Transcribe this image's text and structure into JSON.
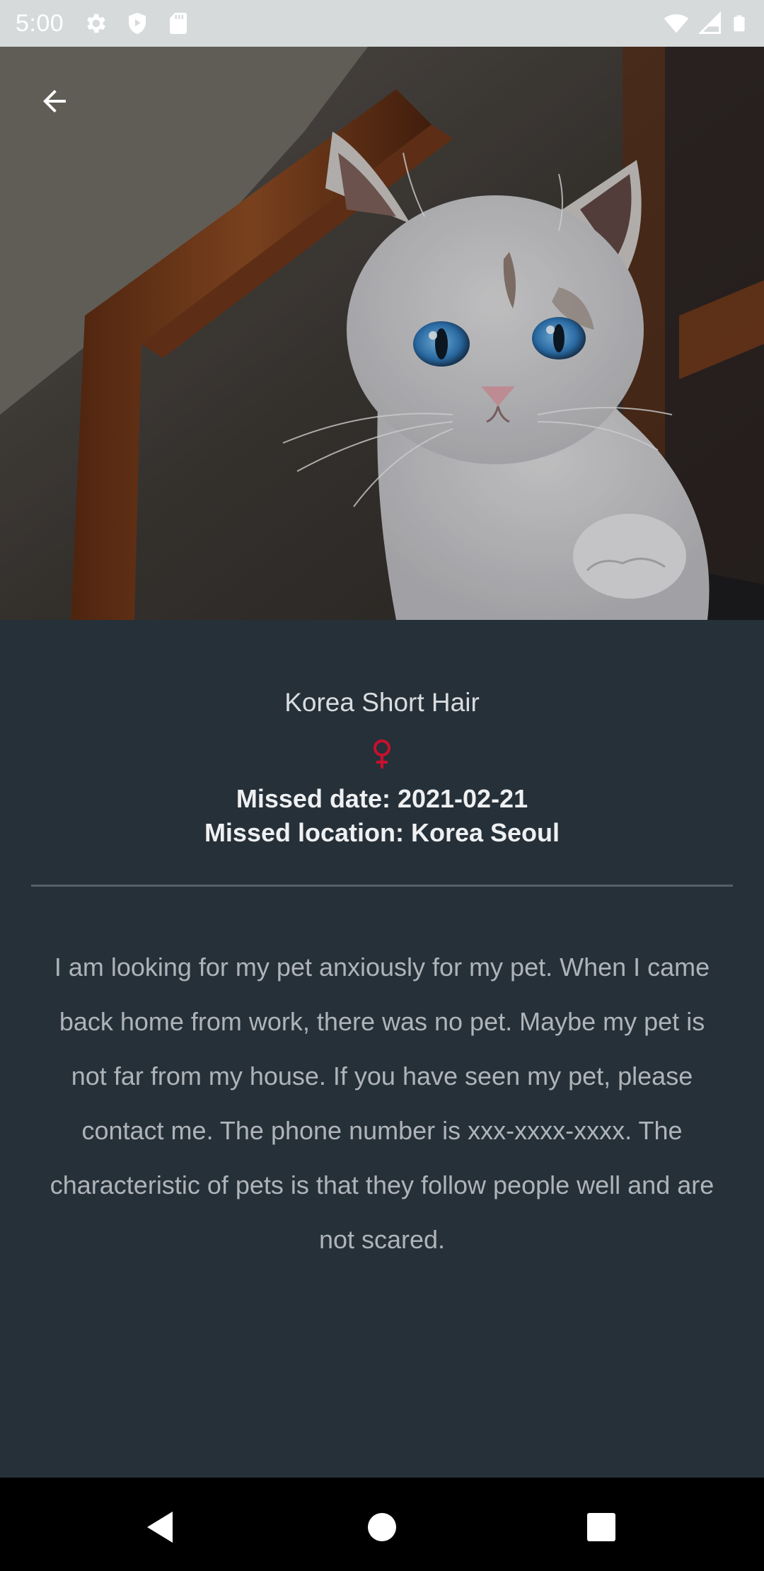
{
  "status_bar": {
    "time": "5:00",
    "left_icons": [
      "settings-icon",
      "shield-icon",
      "sd-card-icon"
    ],
    "right_icons": [
      "wifi-icon",
      "signal-icon",
      "battery-icon"
    ]
  },
  "hero": {
    "back_icon": "arrow-left-icon"
  },
  "pet": {
    "breed": "Korea Short Hair",
    "gender_icon": "female-icon",
    "gender_color": "#c8102e",
    "missed_date": "Missed date: 2021-02-21",
    "missed_location": "Missed location: Korea Seoul",
    "description": "I am looking for my pet anxiously for my pet. When I came back home from work, there was no pet. Maybe my pet is not far from my house. If you have seen my pet, please contact me. The phone number is xxx-xxxx-xxxx. The characteristic of pets is that they follow people well and are not scared."
  },
  "colors": {
    "background": "#263038",
    "status_bar": "#d6dadb",
    "nav_bar": "#000000",
    "divider": "#56606a"
  },
  "nav_bar": {
    "icons": [
      "back-triangle-icon",
      "home-circle-icon",
      "recents-square-icon"
    ]
  }
}
